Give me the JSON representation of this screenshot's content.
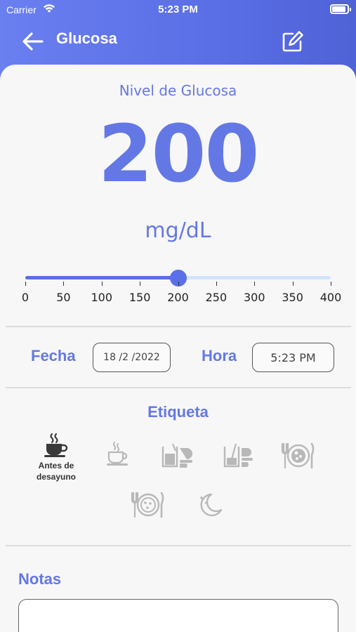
{
  "status_bar": {
    "carrier": "Carrier",
    "time": "5:23 PM"
  },
  "nav": {
    "title": "Glucosa",
    "back_icon": "arrow-left-icon",
    "edit_icon": "edit-icon"
  },
  "glucose": {
    "label": "Nivel de Glucosa",
    "value": "200",
    "unit": "mg/dL",
    "slider_value": 200,
    "slider_min": 0,
    "slider_max": 400,
    "slider_ticks": [
      "0",
      "50",
      "100",
      "150",
      "200",
      "250",
      "300",
      "350",
      "400"
    ]
  },
  "datetime": {
    "date_label": "Fecha",
    "date_value": "18 /2 /2022",
    "time_label": "Hora",
    "time_value": "5:23 PM"
  },
  "tags": {
    "title": "Etiqueta",
    "items": [
      {
        "icon": "coffee-cup-icon",
        "caption": "Antes de desayuno",
        "selected": true
      },
      {
        "icon": "steaming-cup-icon",
        "caption": "",
        "selected": false
      },
      {
        "icon": "juice-sandwich-icon",
        "caption": "",
        "selected": false
      },
      {
        "icon": "glass-sandwich-icon",
        "caption": "",
        "selected": false
      },
      {
        "icon": "plate-fork-knife-icon",
        "caption": "",
        "selected": false
      },
      {
        "icon": "plate-cutlery-icon",
        "caption": "",
        "selected": false
      },
      {
        "icon": "moon-icon",
        "caption": "",
        "selected": false
      }
    ]
  },
  "notes": {
    "label": "Notas",
    "value": ""
  },
  "colors": {
    "accent": "#5b6fe6",
    "text_accent": "#6478e5",
    "icon_inactive": "#b8b8b8",
    "icon_active": "#3a3a3a"
  }
}
